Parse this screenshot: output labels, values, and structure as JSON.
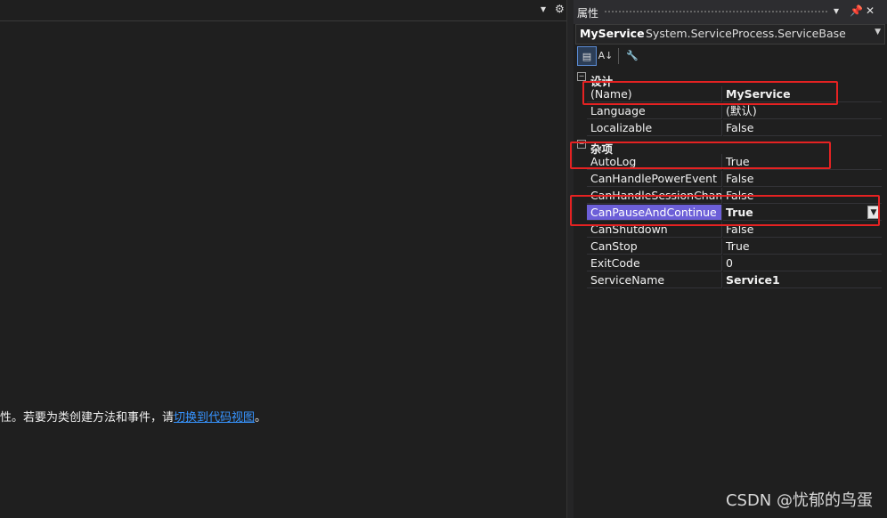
{
  "designer": {
    "message_prefix": "性。若要为类创建方法和事件，请",
    "message_link": "切换到代码视图",
    "message_suffix": "。"
  },
  "panel": {
    "title": "属性",
    "object_name": "MyService",
    "object_type": "System.ServiceProcess.ServiceBase"
  },
  "categories": [
    {
      "title": "设计",
      "rows": [
        {
          "name": "(Name)",
          "value": "MyService",
          "bold": true
        },
        {
          "name": "Language",
          "value": "(默认)"
        },
        {
          "name": "Localizable",
          "value": "False"
        }
      ]
    },
    {
      "title": "杂项",
      "rows": [
        {
          "name": "AutoLog",
          "value": "True"
        },
        {
          "name": "CanHandlePowerEvent",
          "value": "False"
        },
        {
          "name": "CanHandleSessionChangeEvent",
          "value": "False"
        },
        {
          "name": "CanPauseAndContinue",
          "value": "True",
          "selected": true
        },
        {
          "name": "CanShutdown",
          "value": "False"
        },
        {
          "name": "CanStop",
          "value": "True"
        },
        {
          "name": "ExitCode",
          "value": "0"
        },
        {
          "name": "ServiceName",
          "value": "Service1",
          "bold": true
        }
      ]
    }
  ],
  "watermark": "CSDN @忧郁的鸟蛋",
  "colors": {
    "selection": "#6c5fd8",
    "highlight": "#e52222",
    "link": "#3794ff"
  }
}
